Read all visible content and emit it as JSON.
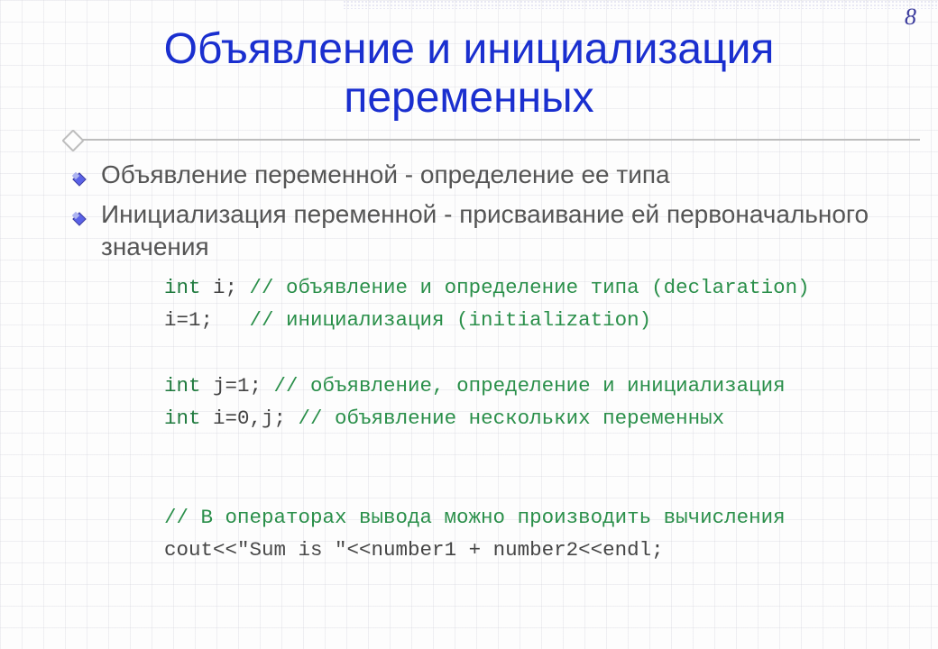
{
  "page_number": "8",
  "title": "Объявление и инициализация переменных",
  "bullets": [
    "Объявление переменной - определение ее типа",
    "Инициализация переменной - присваивание ей первоначального значения"
  ],
  "code": {
    "l1_kw": "int",
    "l1_rest": " i; ",
    "l1_comment": "// объявление и определение типа (declaration)",
    "l2_rest": "i=1;   ",
    "l2_comment": "// инициализация (initialization)",
    "l3_kw": "int",
    "l3_rest": " j=1; ",
    "l3_comment": "// объявление, определение и инициализация",
    "l4_kw": "int",
    "l4_rest": " i=0,j; ",
    "l4_comment": "// объявление нескольких переменных",
    "l5_comment": "// В операторах вывода можно производить вычисления",
    "l6_a": "cout<<",
    "l6_str": "\"Sum is \"",
    "l6_b": "<<number1 + number2<<endl;"
  }
}
